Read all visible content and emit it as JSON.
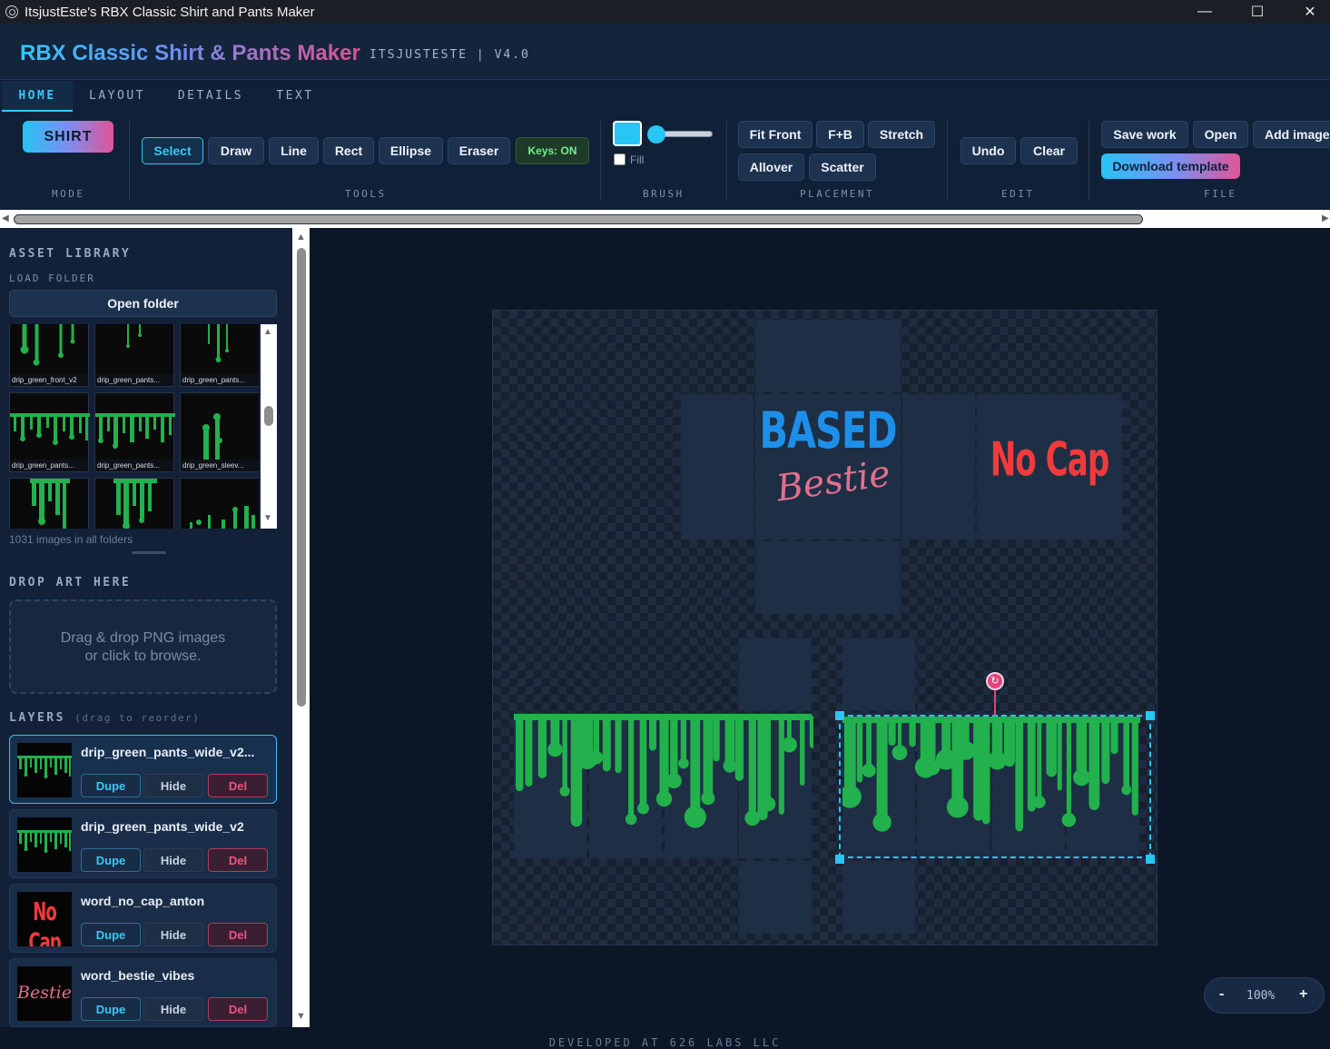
{
  "window": {
    "title": "ItsjustEste's RBX Classic Shirt and Pants Maker",
    "minimize": "—",
    "maximize": "☐",
    "close": "✕"
  },
  "header": {
    "brand": "RBX Classic Shirt & Pants Maker",
    "tag": "ITSJUSTESTE | V4.0"
  },
  "tabs": [
    {
      "label": "HOME",
      "active": true
    },
    {
      "label": "LAYOUT"
    },
    {
      "label": "DETAILS"
    },
    {
      "label": "TEXT"
    }
  ],
  "ribbon": {
    "mode": {
      "button": "SHIRT",
      "label": "MODE"
    },
    "tools": {
      "select": "Select",
      "draw": "Draw",
      "line": "Line",
      "rect": "Rect",
      "ellipse": "Ellipse",
      "eraser": "Eraser",
      "keys": "Keys: ON",
      "label": "TOOLS"
    },
    "brush": {
      "color": "#27c6f5",
      "fill_label": "Fill",
      "fill_checked": false,
      "label": "BRUSH"
    },
    "placement": {
      "fit_front": "Fit Front",
      "fb": "F+B",
      "stretch": "Stretch",
      "allover": "Allover",
      "scatter": "Scatter",
      "label": "PLACEMENT"
    },
    "edit": {
      "undo": "Undo",
      "clear": "Clear",
      "label": "EDIT"
    },
    "file": {
      "save": "Save work",
      "open": "Open",
      "add_image": "Add image",
      "download": "Download template",
      "label": "FILE"
    }
  },
  "sidebar": {
    "asset_library": "ASSET LIBRARY",
    "load_folder": "LOAD FOLDER",
    "open_folder": "Open folder",
    "thumbs": [
      "drip_green_front_v2",
      "drip_green_pants...",
      "drip_green_pants...",
      "drip_green_pants...",
      "drip_green_pants...",
      "drip_green_sleev...",
      "",
      "",
      ""
    ],
    "image_count": "1031 images in all folders",
    "drop_title": "DROP ART HERE",
    "drop_line1": "Drag & drop PNG images",
    "drop_line2": "or click to browse.",
    "layers_title": "LAYERS",
    "layers_hint": "(drag to reorder)",
    "layers": [
      {
        "name": "drip_green_pants_wide_v2...",
        "dupe": "Dupe",
        "hide": "Hide",
        "del": "Del"
      },
      {
        "name": "drip_green_pants_wide_v2",
        "dupe": "Dupe",
        "hide": "Hide",
        "del": "Del"
      },
      {
        "name": "word_no_cap_anton",
        "dupe": "Dupe",
        "hide": "Hide",
        "del": "Del"
      },
      {
        "name": "word_bestie_vibes",
        "dupe": "Dupe",
        "hide": "Hide",
        "del": "Del"
      }
    ]
  },
  "canvas": {
    "art_based": "BASED",
    "art_bestie": "Bestie",
    "art_nocap": "No Cap",
    "thumb_nocap": "No Cap",
    "thumb_bestie": "Bestie",
    "zoom": {
      "minus": "-",
      "value": "100%",
      "plus": "+"
    }
  },
  "footer": "DEVELOPED AT 626 LABS LLC",
  "colors": {
    "accent": "#39c8f5",
    "pink": "#e15496",
    "drip": "#22b14c",
    "nocap": "#ef3b3b",
    "based": "#1e8fe8",
    "bestie": "#e0708e"
  }
}
